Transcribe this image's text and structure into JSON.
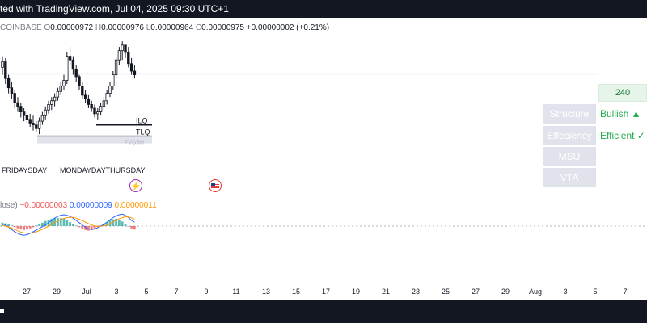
{
  "header": {
    "title": "ted with TradingView.com, Jul 04, 2025 09:30 UTC+1"
  },
  "ohlc_legend": {
    "exchange": "COINBASE",
    "open_key": "O",
    "open": "0.00000972",
    "high_key": "H",
    "high": "0.00000976",
    "low_key": "L",
    "low": "0.00000964",
    "close_key": "C",
    "close": "0.00000975",
    "change": "+0.00000002 (+0.21%)"
  },
  "macd_legend": {
    "label": "lose)",
    "v1": "−0.00000003",
    "v2": "0.00000009",
    "v3": "0.00000011",
    "colors": {
      "v1": "#ef5350",
      "v2": "#2962ff",
      "v3": "#ff9800"
    }
  },
  "annotations": {
    "ilq": "ILQ",
    "tlq": "TLQ",
    "fvg": "FVG5M",
    "day_labels_left": "FRIDAYSDAY",
    "day_labels_mid": "MONDAYDAYTHURSDAY"
  },
  "price_scale": {
    "last_value": "240"
  },
  "table": {
    "rows": [
      {
        "label": "Structure",
        "value": "Bullish ▲"
      },
      {
        "label": "Effeciency",
        "value": "Efficient ✓"
      },
      {
        "label": "MSU",
        "value": ""
      },
      {
        "label": "VTA",
        "value": ""
      }
    ]
  },
  "events": [
    {
      "icon": "lightning-icon"
    },
    {
      "icon": "us-flag-icon"
    }
  ],
  "colors": {
    "topbar_bg": "#131722",
    "bullish": "#22ab4f",
    "macd_hist_pos": "#26a69a",
    "macd_hist_neg": "#ef5350",
    "macd_line": "#2962ff",
    "signal_line": "#ff9800",
    "event_bolt": "#9c27b0",
    "event_flag": "#e53935"
  },
  "chart_data": [
    {
      "type": "candlestick",
      "title": "",
      "x_tick_labels": [
        "27",
        "29",
        "Jul",
        "3",
        "5",
        "7",
        "9",
        "11",
        "13",
        "15",
        "17",
        "19",
        "21",
        "23",
        "25",
        "27",
        "29",
        "Aug",
        "3",
        "5",
        "7"
      ],
      "ohlc_series": [
        {
          "o": 9.64e-06,
          "h": 9.7e-06,
          "l": 9.6e-06,
          "c": 9.67e-06
        },
        {
          "o": 9.67e-06,
          "h": 9.69e-06,
          "l": 9.55e-06,
          "c": 9.58e-06
        },
        {
          "o": 9.58e-06,
          "h": 9.6e-06,
          "l": 9.5e-06,
          "c": 9.53e-06
        },
        {
          "o": 9.53e-06,
          "h": 9.56e-06,
          "l": 9.47e-06,
          "c": 9.5e-06
        },
        {
          "o": 9.5e-06,
          "h": 9.52e-06,
          "l": 9.42e-06,
          "c": 9.45e-06
        },
        {
          "o": 9.45e-06,
          "h": 9.48e-06,
          "l": 9.4e-06,
          "c": 9.43e-06
        },
        {
          "o": 9.43e-06,
          "h": 9.45e-06,
          "l": 9.37e-06,
          "c": 9.4e-06
        },
        {
          "o": 9.4e-06,
          "h": 9.42e-06,
          "l": 9.35e-06,
          "c": 9.38e-06
        },
        {
          "o": 9.38e-06,
          "h": 9.4e-06,
          "l": 9.34e-06,
          "c": 9.36e-06
        },
        {
          "o": 9.36e-06,
          "h": 9.39e-06,
          "l": 9.32e-06,
          "c": 9.34e-06
        },
        {
          "o": 9.34e-06,
          "h": 9.38e-06,
          "l": 9.3e-06,
          "c": 9.33e-06
        },
        {
          "o": 9.33e-06,
          "h": 9.35e-06,
          "l": 9.29e-06,
          "c": 9.31e-06
        },
        {
          "o": 9.31e-06,
          "h": 9.37e-06,
          "l": 9.28e-06,
          "c": 9.35e-06
        },
        {
          "o": 9.35e-06,
          "h": 9.4e-06,
          "l": 9.33e-06,
          "c": 9.38e-06
        },
        {
          "o": 9.38e-06,
          "h": 9.43e-06,
          "l": 9.36e-06,
          "c": 9.41e-06
        },
        {
          "o": 9.41e-06,
          "h": 9.46e-06,
          "l": 9.39e-06,
          "c": 9.44e-06
        },
        {
          "o": 9.44e-06,
          "h": 9.48e-06,
          "l": 9.41e-06,
          "c": 9.46e-06
        },
        {
          "o": 9.46e-06,
          "h": 9.5e-06,
          "l": 9.43e-06,
          "c": 9.48e-06
        },
        {
          "o": 9.48e-06,
          "h": 9.53e-06,
          "l": 9.46e-06,
          "c": 9.51e-06
        },
        {
          "o": 9.51e-06,
          "h": 9.56e-06,
          "l": 9.49e-06,
          "c": 9.54e-06
        },
        {
          "o": 9.54e-06,
          "h": 9.6e-06,
          "l": 9.52e-06,
          "c": 9.57e-06
        },
        {
          "o": 9.57e-06,
          "h": 9.72e-06,
          "l": 9.55e-06,
          "c": 9.7e-06
        },
        {
          "o": 9.7e-06,
          "h": 9.75e-06,
          "l": 9.65e-06,
          "c": 9.68e-06
        },
        {
          "o": 9.68e-06,
          "h": 9.7e-06,
          "l": 9.6e-06,
          "c": 9.63e-06
        },
        {
          "o": 9.63e-06,
          "h": 9.65e-06,
          "l": 9.56e-06,
          "c": 9.59e-06
        },
        {
          "o": 9.59e-06,
          "h": 9.6e-06,
          "l": 9.52e-06,
          "c": 9.54e-06
        },
        {
          "o": 9.54e-06,
          "h": 9.56e-06,
          "l": 9.47e-06,
          "c": 9.49e-06
        },
        {
          "o": 9.49e-06,
          "h": 9.52e-06,
          "l": 9.45e-06,
          "c": 9.47e-06
        },
        {
          "o": 9.47e-06,
          "h": 9.49e-06,
          "l": 9.42e-06,
          "c": 9.44e-06
        },
        {
          "o": 9.44e-06,
          "h": 9.46e-06,
          "l": 9.4e-06,
          "c": 9.42e-06
        },
        {
          "o": 9.42e-06,
          "h": 9.44e-06,
          "l": 9.37e-06,
          "c": 9.39e-06
        },
        {
          "o": 9.39e-06,
          "h": 9.42e-06,
          "l": 9.36e-06,
          "c": 9.4e-06
        },
        {
          "o": 9.4e-06,
          "h": 9.45e-06,
          "l": 9.38e-06,
          "c": 9.43e-06
        },
        {
          "o": 9.43e-06,
          "h": 9.48e-06,
          "l": 9.41e-06,
          "c": 9.46e-06
        },
        {
          "o": 9.46e-06,
          "h": 9.52e-06,
          "l": 9.44e-06,
          "c": 9.5e-06
        },
        {
          "o": 9.5e-06,
          "h": 9.56e-06,
          "l": 9.48e-06,
          "c": 9.54e-06
        },
        {
          "o": 9.54e-06,
          "h": 9.62e-06,
          "l": 9.52e-06,
          "c": 9.6e-06
        },
        {
          "o": 9.6e-06,
          "h": 9.7e-06,
          "l": 9.58e-06,
          "c": 9.68e-06
        },
        {
          "o": 9.68e-06,
          "h": 9.75e-06,
          "l": 9.65e-06,
          "c": 9.73e-06
        },
        {
          "o": 9.73e-06,
          "h": 9.78e-06,
          "l": 9.68e-06,
          "c": 9.76e-06
        },
        {
          "o": 9.76e-06,
          "h": 9.76e-06,
          "l": 9.69e-06,
          "c": 9.72e-06
        },
        {
          "o": 9.72e-06,
          "h": 9.75e-06,
          "l": 9.64e-06,
          "c": 9.66e-06
        },
        {
          "o": 9.66e-06,
          "h": 9.69e-06,
          "l": 9.6e-06,
          "c": 9.62e-06
        },
        {
          "o": 9.62e-06,
          "h": 9.65e-06,
          "l": 9.58e-06,
          "c": 9.6e-06
        }
      ],
      "levels": [
        {
          "label": "ILQ",
          "value": 9.33e-06
        },
        {
          "label": "TLQ",
          "value": 9.27e-06
        }
      ],
      "fvg_zone": {
        "label": "FVG5M",
        "top": 9.27e-06,
        "bottom": 9.23e-06
      },
      "grid": false
    },
    {
      "type": "bar",
      "title": "",
      "histogram": [
        0.3,
        0.25,
        0.15,
        0.05,
        -0.1,
        -0.2,
        -0.3,
        -0.35,
        -0.3,
        -0.2,
        -0.1,
        0.05,
        0.15,
        0.3,
        0.45,
        0.55,
        0.65,
        0.7,
        0.72,
        0.7,
        0.65,
        0.5,
        0.35,
        0.2,
        0.05,
        -0.1,
        -0.25,
        -0.35,
        -0.4,
        -0.35,
        -0.25,
        -0.1,
        0.05,
        0.2,
        0.35,
        0.5,
        0.6,
        0.65,
        0.55,
        0.4,
        0.2,
        0.0,
        -0.2,
        -0.3
      ],
      "macd_line": [
        0.2,
        0.1,
        -0.1,
        -0.3,
        -0.5,
        -0.65,
        -0.75,
        -0.8,
        -0.75,
        -0.65,
        -0.5,
        -0.35,
        -0.2,
        -0.05,
        0.1,
        0.3,
        0.5,
        0.7,
        0.85,
        0.95,
        1.0,
        0.95,
        0.85,
        0.7,
        0.5,
        0.3,
        0.1,
        -0.1,
        -0.25,
        -0.3,
        -0.25,
        -0.15,
        0.0,
        0.15,
        0.35,
        0.55,
        0.75,
        0.9,
        1.0,
        1.05,
        0.95,
        0.75,
        0.5,
        0.35
      ],
      "signal_line": [
        0.05,
        0.0,
        -0.08,
        -0.18,
        -0.3,
        -0.42,
        -0.52,
        -0.6,
        -0.63,
        -0.62,
        -0.58,
        -0.5,
        -0.4,
        -0.28,
        -0.15,
        0.0,
        0.15,
        0.3,
        0.45,
        0.58,
        0.68,
        0.75,
        0.78,
        0.77,
        0.7,
        0.6,
        0.48,
        0.35,
        0.22,
        0.1,
        0.02,
        -0.02,
        -0.02,
        0.02,
        0.1,
        0.22,
        0.38,
        0.52,
        0.65,
        0.75,
        0.82,
        0.8,
        0.72,
        0.62
      ],
      "zero_line": 0
    }
  ]
}
